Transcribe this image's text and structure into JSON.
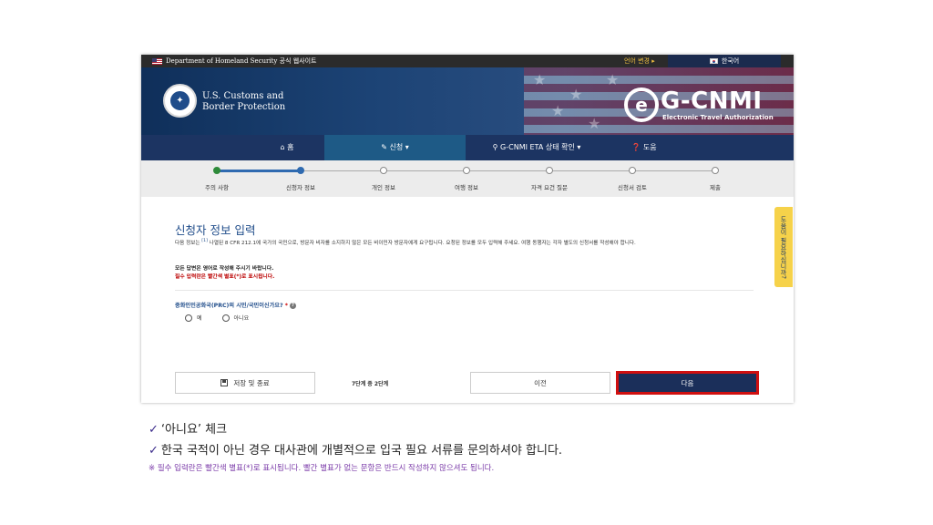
{
  "gov_banner": {
    "text": "Department of Homeland Security 공식 웹사이트",
    "language_change": "언어 변경 ▸",
    "current_language": "한국어"
  },
  "header": {
    "agency_name": "U.S. Customs and Border Protection",
    "logo_title": "G-CNMI",
    "logo_subtitle": "Electronic Travel Authorization"
  },
  "nav": {
    "home": "홈",
    "apply": "신청",
    "status": "G-CNMI ETA 상태 확인",
    "help": "도움"
  },
  "progress": {
    "steps": [
      "주의 사항",
      "신청자 정보",
      "개인 정보",
      "여행 정보",
      "자격 요건 질문",
      "신청서 검토",
      "제출"
    ],
    "completed": 1,
    "current": 1
  },
  "form": {
    "title": "신청자 정보 입력",
    "intro_prefix": "다음 정보는",
    "intro_sup": "[1]",
    "intro_rest": " 나열된 8 CFR 212.1에 국가의 국민으로, 방문자 비자를 소지하지 않은 모든 비이민자 방문자에게 요구됩니다. 요청된 정보를 모두 입력해 주세요. 여행 동행자는 각자 별도의 신청서를 작성해야 합니다.",
    "english_note": "모든 답변은 영어로 작성해 주시기 바랍니다.",
    "required_note": "필수 입력란은 빨간색 별표(*)로 표시됩니다.",
    "question": "중화인민공화국(PRC)의 시민/국민이신가요?",
    "required_mark": "*",
    "options": [
      "예",
      "아니요"
    ],
    "selected": ""
  },
  "footer_buttons": {
    "save": "저장 및 종료",
    "step_count": "7단계 중 2단계",
    "previous": "이전",
    "next": "다음"
  },
  "help_tab": "도움이 필요하십니까?",
  "captions": {
    "line1": "‘아니요’ 체크",
    "line2": "한국 국적이 아닌 경우 대사관에 개별적으로 입국 필요 서류를 문의하셔야 합니다.",
    "footnote": "※ 필수 입력란은 빨간색 별표(*)로 표시됩니다. 빨간 별표가 없는 문항은 반드시 작성하지 않으셔도 됩니다."
  },
  "colors": {
    "navy": "#1c3462",
    "accent_blue": "#1f4c8a",
    "highlight_red": "#d01010",
    "help_yellow": "#f6d24a"
  },
  "icons": {
    "home": "home-icon",
    "apply": "pencil-icon",
    "status": "search-icon",
    "help": "question-circle-icon",
    "save": "floppy-disk-icon"
  }
}
